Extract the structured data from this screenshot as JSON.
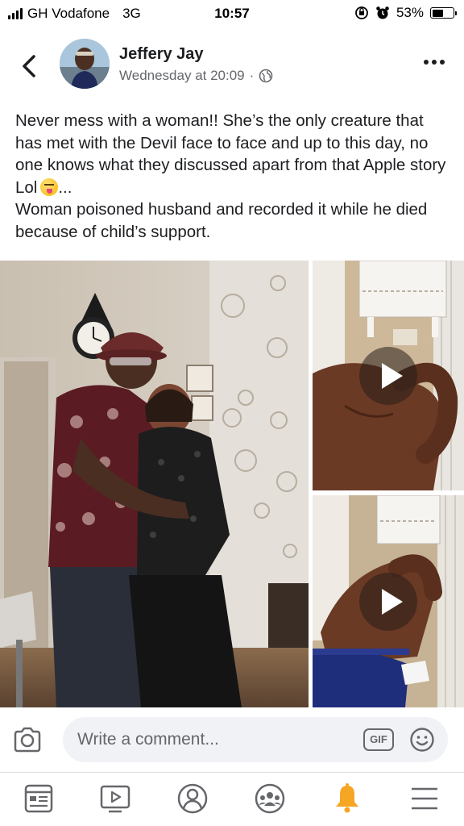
{
  "status_bar": {
    "carrier": "GH Vodafone",
    "network": "3G",
    "time": "10:57",
    "battery": "53%",
    "battery_level": 0.53,
    "icons": [
      "signal-icon",
      "rotation-lock-icon",
      "alarm-icon",
      "battery-icon"
    ]
  },
  "post": {
    "author": "Jeffery Jay",
    "timestamp": "Wednesday at 20:09",
    "separator": "·",
    "privacy_icon": "globe-icon",
    "text_line1": "Never mess with a woman!! She’s the only creature that has met with the Devil face to face and up to this day, no one knows what they discussed apart from that Apple story Lol",
    "text_line1_tail": "...",
    "text_line2": "Woman poisoned husband and recorded it while he died because of child’s support.",
    "emoji": "tongue-out-face-emoji"
  },
  "media": {
    "photos": [
      "couple-photo",
      "video-thumbnail-1",
      "video-thumbnail-2"
    ],
    "play_icon": "play-icon"
  },
  "comment_bar": {
    "placeholder": "Write a comment...",
    "gif_label": "GIF",
    "camera_icon": "camera-icon",
    "emoji_icon": "smiley-icon"
  },
  "bottom_nav": {
    "items": [
      "news-feed-icon",
      "watch-icon",
      "profile-icon",
      "groups-icon",
      "notifications-icon",
      "menu-icon"
    ],
    "accent": "#f5a623"
  },
  "colors": {
    "text": "#1c1e21",
    "secondary": "#65676b",
    "input_bg": "#f0f2f5"
  }
}
